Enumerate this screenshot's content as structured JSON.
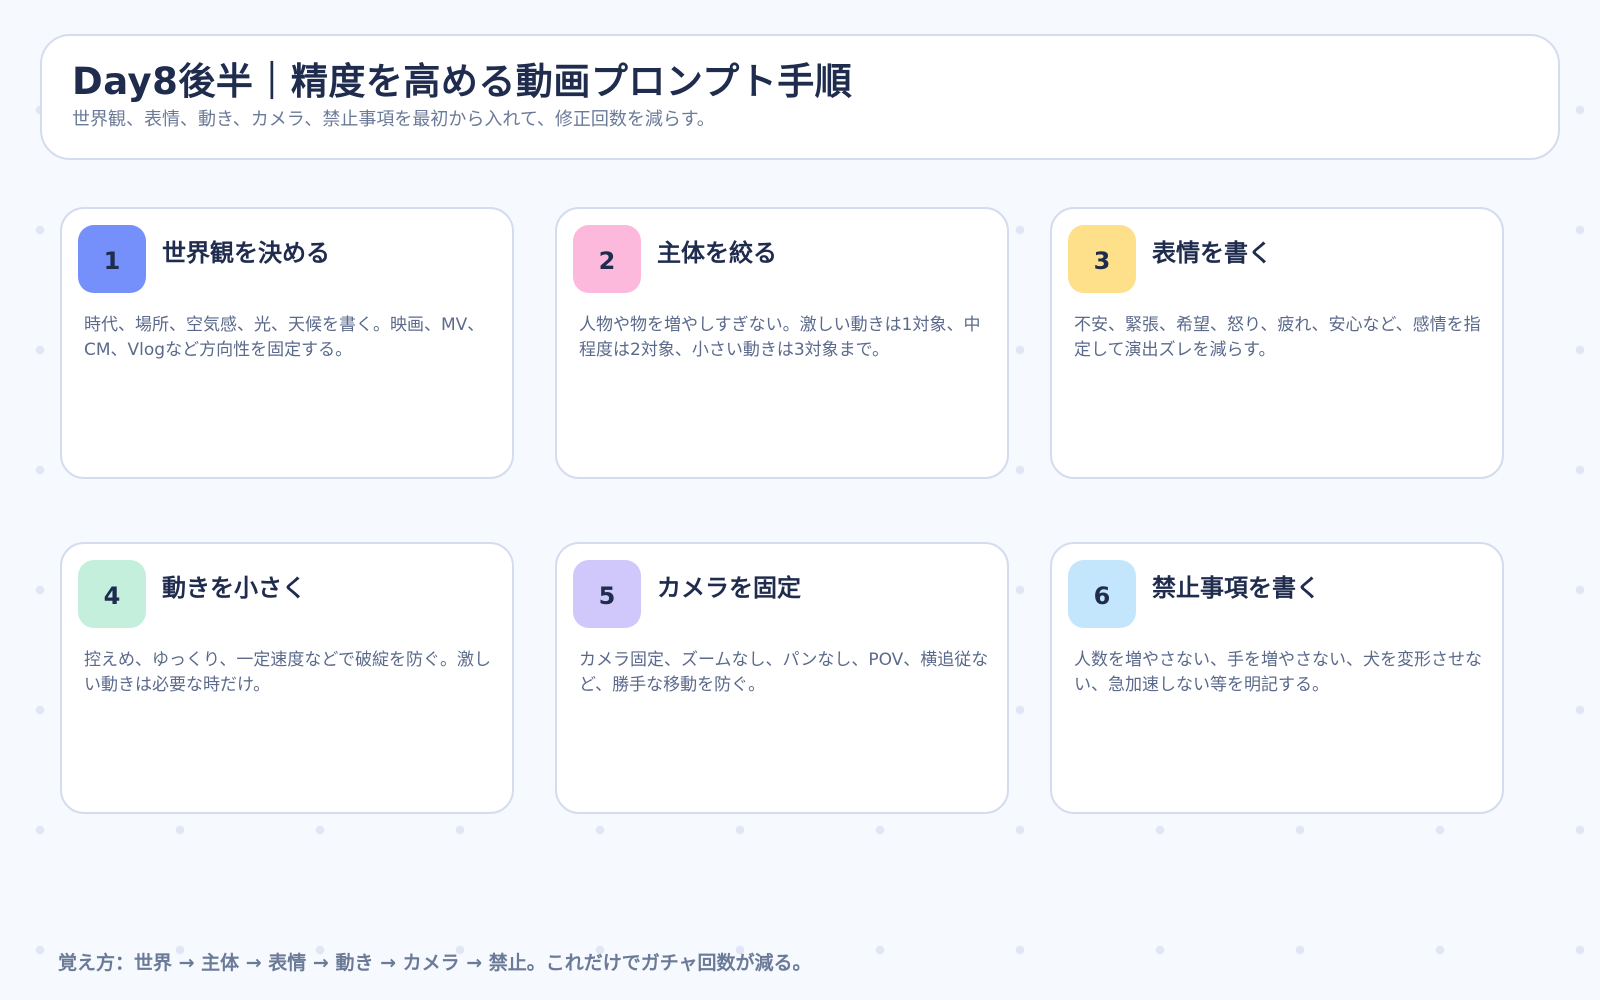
{
  "header": {
    "title": "Day8後半｜精度を高める動画プロンプト手順",
    "subtitle": "世界観、表情、動き、カメラ、禁止事項を最初から入れて、修正回数を減らす。"
  },
  "cards": [
    {
      "number": "1",
      "title": "世界観を決める",
      "desc": "時代、場所、空気感、光、天候を書く。映画、MV、CM、Vlogなど方向性を固定する。",
      "color": "#7590fb"
    },
    {
      "number": "2",
      "title": "主体を絞る",
      "desc": "人物や物を増やしすぎない。激しい動きは1対象、中程度は2対象、小さい動きは3対象まで。",
      "color": "#fdb9db"
    },
    {
      "number": "3",
      "title": "表情を書く",
      "desc": "不安、緊張、希望、怒り、疲れ、安心など、感情を指定して演出ズレを減らす。",
      "color": "#fedf8a"
    },
    {
      "number": "4",
      "title": "動きを小さく",
      "desc": "控えめ、ゆっくり、一定速度などで破綻を防ぐ。激しい動きは必要な時だけ。",
      "color": "#c5efdd"
    },
    {
      "number": "5",
      "title": "カメラを固定",
      "desc": "カメラ固定、ズームなし、パンなし、POV、横追従など、勝手な移動を防ぐ。",
      "color": "#d0c7fb"
    },
    {
      "number": "6",
      "title": "禁止事項を書く",
      "desc": "人数を増やさない、手を増やさない、犬を変形させない、急加速しない等を明記する。",
      "color": "#c3e6fd"
    }
  ],
  "footer": {
    "text": "覚え方：世界 → 主体 → 表情 → 動き → カメラ → 禁止。これだけでガチャ回数が減る。"
  }
}
